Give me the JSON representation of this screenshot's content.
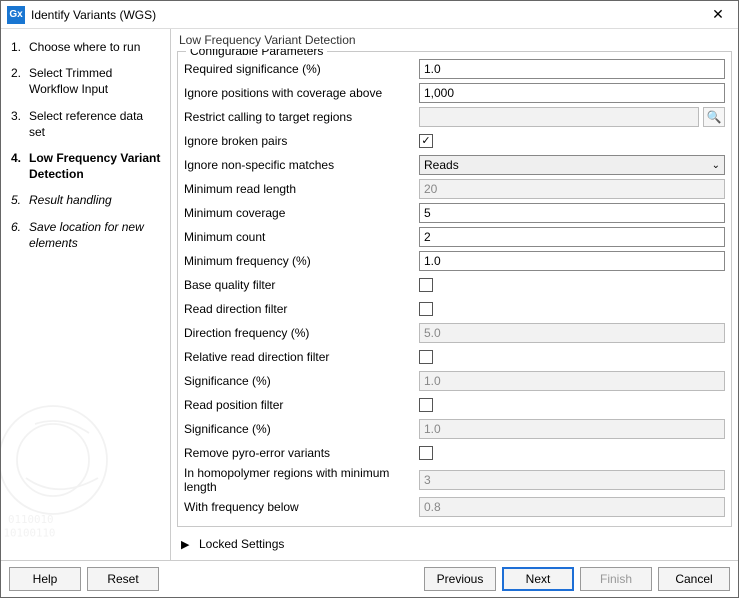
{
  "app_icon_text": "Gx",
  "window_title": "Identify Variants (WGS)",
  "close_glyph": "✕",
  "sidebar": {
    "steps": [
      {
        "num": "1.",
        "label": "Choose where to run",
        "current": false,
        "italic": false
      },
      {
        "num": "2.",
        "label": "Select Trimmed Workflow Input",
        "current": false,
        "italic": false
      },
      {
        "num": "3.",
        "label": "Select reference data set",
        "current": false,
        "italic": false
      },
      {
        "num": "4.",
        "label": "Low Frequency Variant Detection",
        "current": true,
        "italic": false
      },
      {
        "num": "5.",
        "label": "Result handling",
        "current": false,
        "italic": true
      },
      {
        "num": "6.",
        "label": "Save location for new elements",
        "current": false,
        "italic": true
      }
    ]
  },
  "main": {
    "heading": "Low Frequency Variant Detection",
    "fieldset_legend": "Configurable Parameters",
    "params": [
      {
        "key": "required_significance",
        "label": "Required significance (%)",
        "type": "text",
        "value": "1.0",
        "disabled": false
      },
      {
        "key": "ignore_cov_above",
        "label": "Ignore positions with coverage above",
        "type": "text",
        "value": "1,000",
        "disabled": false
      },
      {
        "key": "restrict_target",
        "label": "Restrict calling to target regions",
        "type": "browse",
        "value": "",
        "disabled": true
      },
      {
        "key": "ignore_broken_pairs",
        "label": "Ignore broken pairs",
        "type": "checkbox",
        "value": "true"
      },
      {
        "key": "ignore_non_specific",
        "label": "Ignore non-specific matches",
        "type": "select",
        "value": "Reads"
      },
      {
        "key": "min_read_length",
        "label": "Minimum read length",
        "type": "text",
        "value": "20",
        "disabled": true
      },
      {
        "key": "min_coverage",
        "label": "Minimum coverage",
        "type": "text",
        "value": "5",
        "disabled": false
      },
      {
        "key": "min_count",
        "label": "Minimum count",
        "type": "text",
        "value": "2",
        "disabled": false
      },
      {
        "key": "min_frequency",
        "label": "Minimum frequency (%)",
        "type": "text",
        "value": "1.0",
        "disabled": false
      },
      {
        "key": "base_quality_filter",
        "label": "Base quality filter",
        "type": "checkbox",
        "value": "false"
      },
      {
        "key": "read_direction_filter",
        "label": "Read direction filter",
        "type": "checkbox",
        "value": "false"
      },
      {
        "key": "direction_frequency",
        "label": "Direction frequency (%)",
        "type": "text",
        "value": "5.0",
        "disabled": true
      },
      {
        "key": "relative_read_direction_filter",
        "label": "Relative read direction filter",
        "type": "checkbox",
        "value": "false"
      },
      {
        "key": "significance_1",
        "label": "Significance (%)",
        "type": "text",
        "value": "1.0",
        "disabled": true
      },
      {
        "key": "read_position_filter",
        "label": "Read position filter",
        "type": "checkbox",
        "value": "false"
      },
      {
        "key": "significance_2",
        "label": "Significance (%)",
        "type": "text",
        "value": "1.0",
        "disabled": true
      },
      {
        "key": "remove_pyro",
        "label": "Remove pyro-error variants",
        "type": "checkbox",
        "value": "false"
      },
      {
        "key": "homopolymer_min_len",
        "label": "In homopolymer regions with minimum length",
        "type": "text",
        "value": "3",
        "disabled": true
      },
      {
        "key": "freq_below",
        "label": "With frequency below",
        "type": "text",
        "value": "0.8",
        "disabled": true
      }
    ],
    "locked_label": "Locked Settings",
    "locked_arrow": "▶"
  },
  "footer": {
    "help": "Help",
    "reset": "Reset",
    "previous": "Previous",
    "next": "Next",
    "finish": "Finish",
    "cancel": "Cancel"
  },
  "icons": {
    "browse": "🔍",
    "chevron": "⌄",
    "check": "✓"
  }
}
